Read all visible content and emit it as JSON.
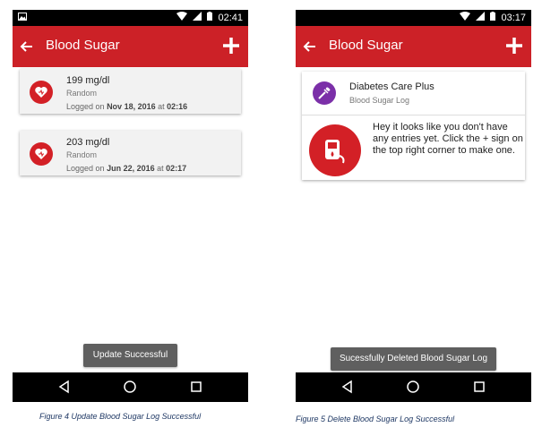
{
  "screen1": {
    "status_time": "02:41",
    "toolbar_title": "Blood Sugar",
    "entries": [
      {
        "reading": "199 mg/dl",
        "kind": "Random",
        "logged_prefix": "Logged on",
        "date": "Nov 18, 2016",
        "at": "at",
        "time": "02:16"
      },
      {
        "reading": "203 mg/dl",
        "kind": "Random",
        "logged_prefix": "Logged on",
        "date": "Jun 22, 2016",
        "at": "at",
        "time": "02:17"
      }
    ],
    "toast": "Update Successful",
    "caption": "Figure 4 Update Blood Sugar Log Successful"
  },
  "screen2": {
    "status_time": "03:17",
    "toolbar_title": "Blood Sugar",
    "app_name": "Diabetes Care Plus",
    "app_subtitle": "Blood Sugar Log",
    "empty_message": "Hey it looks like you don't have any entries yet. Click the + sign on the top right corner to make one.",
    "toast": "Sucessfully Deleted Blood Sugar Log",
    "caption": "Figure 5 Delete Blood Sugar Log Successful"
  },
  "colors": {
    "app_bar": "#cc2127",
    "accent_red": "#d32026",
    "app_icon_purple": "#7b2fa8",
    "toast_bg": "#5f5f5f",
    "caption_text": "#1f3864"
  },
  "icons": [
    "image-icon",
    "wifi-icon",
    "signal-icon",
    "battery-icon",
    "back-arrow-icon",
    "add-icon",
    "heart-icon",
    "syringe-pill-icon",
    "blood-drop-device-icon",
    "nav-back-icon",
    "nav-home-icon",
    "nav-recents-icon"
  ]
}
